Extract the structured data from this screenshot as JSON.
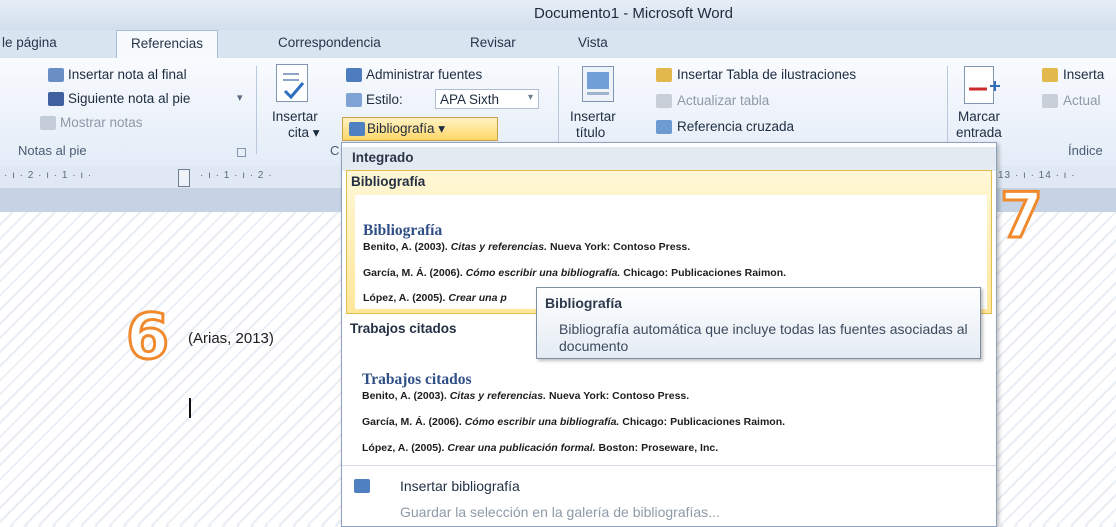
{
  "window": {
    "title": "Documento1 - Microsoft Word"
  },
  "tabs": [
    "le página",
    "Referencias",
    "Correspondencia",
    "Revisar",
    "Vista"
  ],
  "ribbon": {
    "footnotes": {
      "insert_endnote": "Insertar nota al final",
      "next_footnote": "Siguiente nota al pie",
      "next_footnote_arrow": "▾",
      "show_notes": "Mostrar notas",
      "group_label": "Notas al pie",
      "launcher_icon": "dialog-launcher-icon"
    },
    "citations": {
      "insert_citation_line1": "Insertar",
      "insert_citation_line2": "cita ▾",
      "manage_sources": "Administrar fuentes",
      "style_label": "Estilo:",
      "style_value": "APA Sixth",
      "style_arrow": "▾",
      "bibliography": "Bibliografía ▾",
      "group_label_partial": "C"
    },
    "captions": {
      "insert_caption_line1": "Insertar",
      "insert_caption_line2": "título",
      "insert_table_of_figures": "Insertar Tabla de ilustraciones",
      "update_table": "Actualizar tabla",
      "cross_reference": "Referencia cruzada"
    },
    "index": {
      "mark_entry_line1": "Marcar",
      "mark_entry_line2": "entrada",
      "insert_index": "Inserta",
      "update_index": "Actual",
      "group_label": "Índice"
    }
  },
  "ruler": {
    "left_text": "· ı · 2 · ı · 1 · ı ·",
    "left_text2": "· ı · 1 · ı · 2 ·",
    "right_text": "13 · ı · 14 · ı ·"
  },
  "dropdown": {
    "section_builtin": "Integrado",
    "items": [
      {
        "label": "Bibliografía",
        "heading": "Bibliografía",
        "entries": [
          {
            "author": "Benito, A. (2003). ",
            "title": "Citas y referencias.",
            "rest": " Nueva York: Contoso Press."
          },
          {
            "author": "García, M. Á. (2006). ",
            "title": "Cómo escribir una bibliografía.",
            "rest": " Chicago: Publicaciones Raimon."
          },
          {
            "author": "López, A. (2005). ",
            "title": "Crear una p",
            "rest": ""
          }
        ]
      },
      {
        "label": "Trabajos citados",
        "heading": "Trabajos citados",
        "entries": [
          {
            "author": "Benito, A. (2003). ",
            "title": "Citas y referencias.",
            "rest": " Nueva York: Contoso Press."
          },
          {
            "author": "García, M. Á. (2006). ",
            "title": "Cómo escribir una bibliografía.",
            "rest": " Chicago: Publicaciones Raimon."
          },
          {
            "author": "López, A. (2005). ",
            "title": "Crear una publicación formal.",
            "rest": " Boston: Proseware, Inc."
          }
        ]
      }
    ],
    "insert_bibliography": "Insertar bibliografía",
    "save_selection": "Guardar la selección en la galería de bibliografías..."
  },
  "tooltip": {
    "title": "Bibliografía",
    "body": "Bibliografía automática que incluye todas las fuentes asociadas al documento"
  },
  "document": {
    "citation": "(Arias, 2013)"
  },
  "annotations": {
    "left_number": "6",
    "right_number": "7"
  },
  "colors": {
    "accent_orange": "#f08a2c",
    "selected_gallery": "#ffe79a",
    "ribbon_blue": "#d9e4f1"
  }
}
